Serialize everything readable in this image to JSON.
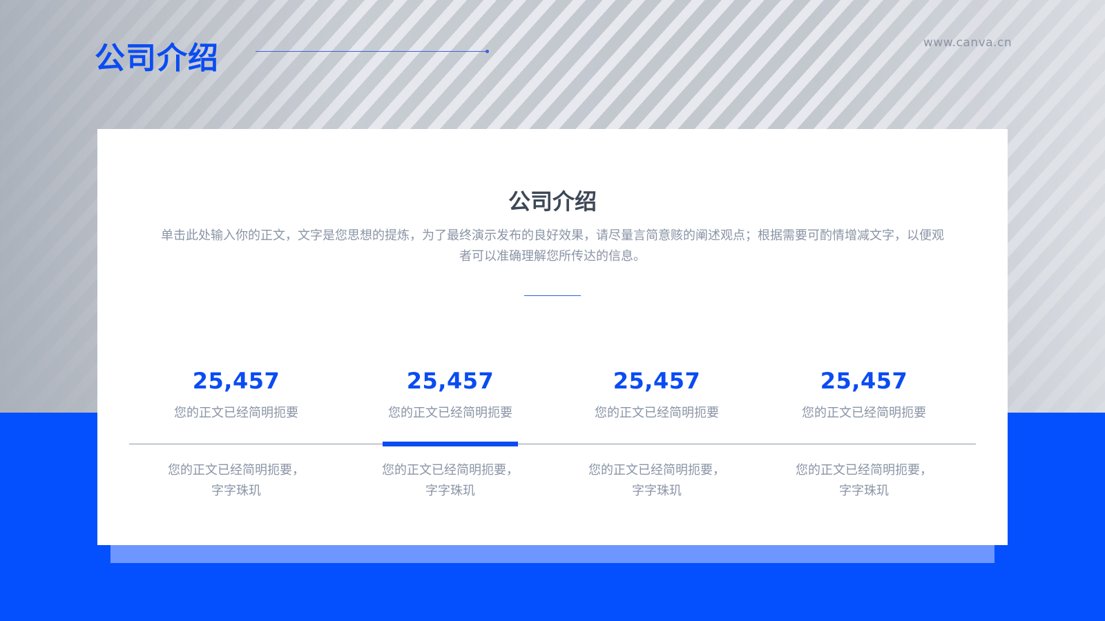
{
  "header": {
    "title": "公司介绍",
    "watermark": "www.canva.cn"
  },
  "card": {
    "title": "公司介绍",
    "body": "单击此处输入你的正文，文字是您思想的提炼，为了最终演示发布的良好效果，请尽量言简意赅的阐述观点；根据需要可酌情增减文字，以便观者可以准确理解您所传达的信息。",
    "stats": [
      {
        "number": "25,457",
        "label": "您的正文已经简明扼要",
        "desc_line1": "您的正文已经简明扼要，",
        "desc_line2": "字字珠玑"
      },
      {
        "number": "25,457",
        "label": "您的正文已经简明扼要",
        "desc_line1": "您的正文已经简明扼要，",
        "desc_line2": "字字珠玑"
      },
      {
        "number": "25,457",
        "label": "您的正文已经简明扼要",
        "desc_line1": "您的正文已经简明扼要，",
        "desc_line2": "字字珠玑"
      },
      {
        "number": "25,457",
        "label": "您的正文已经简明扼要",
        "desc_line1": "您的正文已经简明扼要，",
        "desc_line2": "字字珠玑"
      }
    ],
    "active_index": 1
  },
  "colors": {
    "accent_blue": "#0a4cf2",
    "band_blue": "#0450ff",
    "shadow_blue": "#6e96ff",
    "heading_gray": "#3d4756",
    "body_gray": "#8a94a6"
  }
}
